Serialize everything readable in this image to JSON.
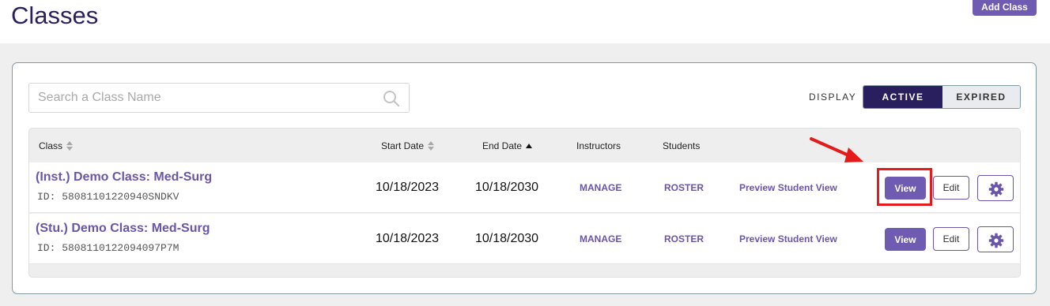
{
  "header": {
    "title": "Classes",
    "add_class_label": "Add Class"
  },
  "search": {
    "placeholder": "Search a Class Name",
    "value": ""
  },
  "display": {
    "label": "DISPLAY",
    "active_label": "ACTIVE",
    "expired_label": "EXPIRED",
    "selected": "ACTIVE"
  },
  "table": {
    "columns": {
      "class": "Class",
      "start_date": "Start Date",
      "end_date": "End Date",
      "instructors": "Instructors",
      "students": "Students"
    },
    "rows": [
      {
        "name": "(Inst.) Demo Class: Med-Surg",
        "id": "ID: 58081101220940SNDKV",
        "start_date": "10/18/2023",
        "end_date": "10/18/2030",
        "instructors_action": "MANAGE",
        "students_action": "ROSTER",
        "preview": "Preview Student View",
        "view_label": "View",
        "edit_label": "Edit"
      },
      {
        "name": "(Stu.) Demo Class: Med-Surg",
        "id": "ID: 5808110122094097P7M",
        "start_date": "10/18/2023",
        "end_date": "10/18/2030",
        "instructors_action": "MANAGE",
        "students_action": "ROSTER",
        "preview": "Preview Student View",
        "view_label": "View",
        "edit_label": "Edit"
      }
    ]
  },
  "colors": {
    "accent": "#6f5bb1",
    "dark": "#2a1f5e",
    "highlight": "#e31b1b"
  },
  "icons": [
    "search-icon",
    "sort-icon",
    "sort-ascending-icon",
    "gear-icon",
    "arrow-icon"
  ]
}
